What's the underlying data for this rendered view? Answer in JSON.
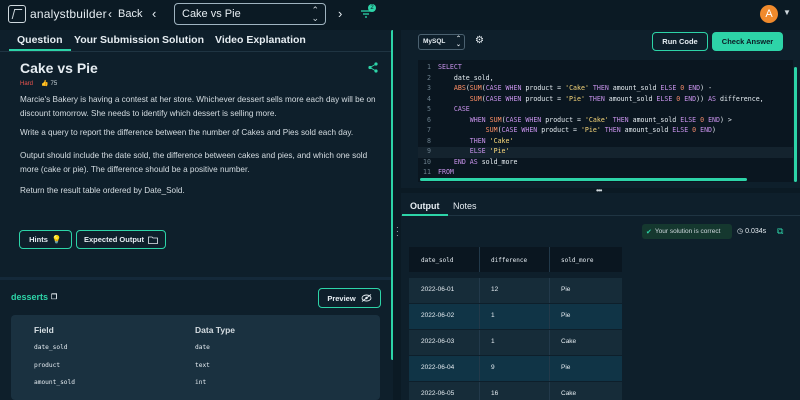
{
  "header": {
    "logo_text": "analystbuilder",
    "back_label": "Back",
    "question_select": "Cake vs Pie",
    "filter_badge": "2",
    "avatar_letter": "A"
  },
  "left_tabs": [
    "Question",
    "Your Submission",
    "Solution",
    "Video Explanation"
  ],
  "question": {
    "title": "Cake vs Pie",
    "difficulty": "Hard",
    "likes": "75",
    "paragraphs": [
      "Marcie's Bakery is having a contest at her store. Whichever dessert sells more each day will be on discount tomorrow. She needs to identify which dessert is selling more.",
      "Write a query to report the difference between the number of Cakes and Pies sold each day.",
      "Output should include the date sold, the difference between cakes and pies, and which one sold more (cake or pie). The difference should be a positive number.",
      "Return the result table ordered by Date_Sold."
    ],
    "hints_label": "Hints",
    "expected_label": "Expected Output"
  },
  "schema": {
    "table_name": "desserts",
    "preview_label": "Preview",
    "col_header_field": "Field",
    "col_header_type": "Data Type",
    "rows": [
      {
        "field": "date_sold",
        "type": "date"
      },
      {
        "field": "product",
        "type": "text"
      },
      {
        "field": "amount_sold",
        "type": "int"
      }
    ]
  },
  "editor": {
    "language": "MySQL",
    "run_label": "Run Code",
    "check_label": "Check Answer",
    "lines": [
      {
        "n": "1",
        "segs": [
          [
            "kw",
            "SELECT"
          ]
        ]
      },
      {
        "n": "2",
        "segs": [
          [
            "",
            "    date_sold,"
          ]
        ]
      },
      {
        "n": "3",
        "segs": [
          [
            "",
            "    "
          ],
          [
            "fn",
            "ABS"
          ],
          [
            "",
            "("
          ],
          [
            "fn",
            "SUM"
          ],
          [
            "",
            "("
          ],
          [
            "kw",
            "CASE WHEN"
          ],
          [
            "",
            " product = "
          ],
          [
            "str",
            "'Cake'"
          ],
          [
            "kw",
            " THEN"
          ],
          [
            "",
            " amount_sold "
          ],
          [
            "kw",
            "ELSE"
          ],
          [
            "num",
            " 0"
          ],
          [
            "kw",
            " END"
          ],
          [
            "",
            ") -"
          ]
        ]
      },
      {
        "n": "4",
        "segs": [
          [
            "",
            "        "
          ],
          [
            "fn",
            "SUM"
          ],
          [
            "",
            "("
          ],
          [
            "kw",
            "CASE WHEN"
          ],
          [
            "",
            " product = "
          ],
          [
            "str",
            "'Pie'"
          ],
          [
            "kw",
            " THEN"
          ],
          [
            "",
            " amount_sold "
          ],
          [
            "kw",
            "ELSE"
          ],
          [
            "num",
            " 0"
          ],
          [
            "kw",
            " END"
          ],
          [
            "",
            ")) "
          ],
          [
            "kw",
            "AS"
          ],
          [
            "",
            " difference,"
          ]
        ]
      },
      {
        "n": "5",
        "segs": [
          [
            "",
            "    "
          ],
          [
            "kw",
            "CASE"
          ]
        ]
      },
      {
        "n": "6",
        "segs": [
          [
            "",
            "        "
          ],
          [
            "kw",
            "WHEN"
          ],
          [
            "",
            " "
          ],
          [
            "fn",
            "SUM"
          ],
          [
            "",
            "("
          ],
          [
            "kw",
            "CASE WHEN"
          ],
          [
            "",
            " product = "
          ],
          [
            "str",
            "'Cake'"
          ],
          [
            "kw",
            " THEN"
          ],
          [
            "",
            " amount_sold "
          ],
          [
            "kw",
            "ELSE"
          ],
          [
            "num",
            " 0"
          ],
          [
            "kw",
            " END"
          ],
          [
            "",
            ") >"
          ]
        ]
      },
      {
        "n": "7",
        "segs": [
          [
            "",
            "            "
          ],
          [
            "fn",
            "SUM"
          ],
          [
            "",
            "("
          ],
          [
            "kw",
            "CASE WHEN"
          ],
          [
            "",
            " product = "
          ],
          [
            "str",
            "'Pie'"
          ],
          [
            "kw",
            " THEN"
          ],
          [
            "",
            " amount_sold "
          ],
          [
            "kw",
            "ELSE"
          ],
          [
            "num",
            " 0"
          ],
          [
            "kw",
            " END"
          ],
          [
            "",
            ")"
          ]
        ]
      },
      {
        "n": "8",
        "segs": [
          [
            "",
            "        "
          ],
          [
            "kw",
            "THEN"
          ],
          [
            "",
            " "
          ],
          [
            "str",
            "'Cake'"
          ]
        ]
      },
      {
        "n": "9",
        "segs": [
          [
            "",
            "        "
          ],
          [
            "kw",
            "ELSE"
          ],
          [
            "",
            " "
          ],
          [
            "str",
            "'Pie'"
          ]
        ]
      },
      {
        "n": "10",
        "segs": [
          [
            "",
            "    "
          ],
          [
            "kw",
            "END AS"
          ],
          [
            "",
            " sold_more"
          ]
        ]
      },
      {
        "n": "11",
        "segs": [
          [
            "kw",
            "FROM"
          ]
        ]
      }
    ]
  },
  "output": {
    "tabs": [
      "Output",
      "Notes"
    ],
    "status": "Your solution is correct",
    "time": "0.034s",
    "columns": [
      "date_sold",
      "difference",
      "sold_more"
    ],
    "rows": [
      [
        "2022-06-01",
        "12",
        "Pie"
      ],
      [
        "2022-06-02",
        "1",
        "Pie"
      ],
      [
        "2022-06-03",
        "1",
        "Cake"
      ],
      [
        "2022-06-04",
        "9",
        "Pie"
      ],
      [
        "2022-06-05",
        "16",
        "Cake"
      ]
    ]
  },
  "colors": {
    "accent": "#2dd4a8",
    "hard": "#f0554f",
    "avatar": "#f08a2c"
  },
  "icons": [
    "logo-icon",
    "chevron-left-icon",
    "chevron-right-icon",
    "filter-icon",
    "share-icon",
    "like-icon",
    "bulb-icon",
    "folder-icon",
    "copy-icon",
    "eye-off-icon",
    "gear-icon",
    "check-icon",
    "clock-icon",
    "external-link-icon"
  ]
}
